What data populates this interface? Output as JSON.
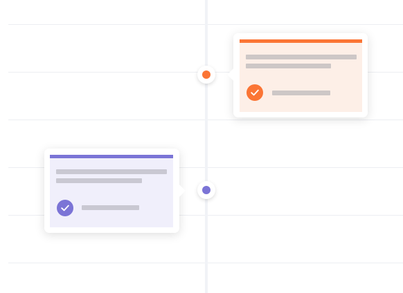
{
  "timeline": {
    "events": [
      {
        "id": "event-1",
        "side": "right",
        "accent_color": "#fb7535",
        "panel_color": "#fdefe7",
        "placeholder_color": "#cdc7c6",
        "checked": true,
        "icon": "check-icon"
      },
      {
        "id": "event-2",
        "side": "left",
        "accent_color": "#7b74d6",
        "panel_color": "#f0effb",
        "placeholder_color": "#c9c8d2",
        "checked": true,
        "icon": "check-icon"
      }
    ]
  }
}
